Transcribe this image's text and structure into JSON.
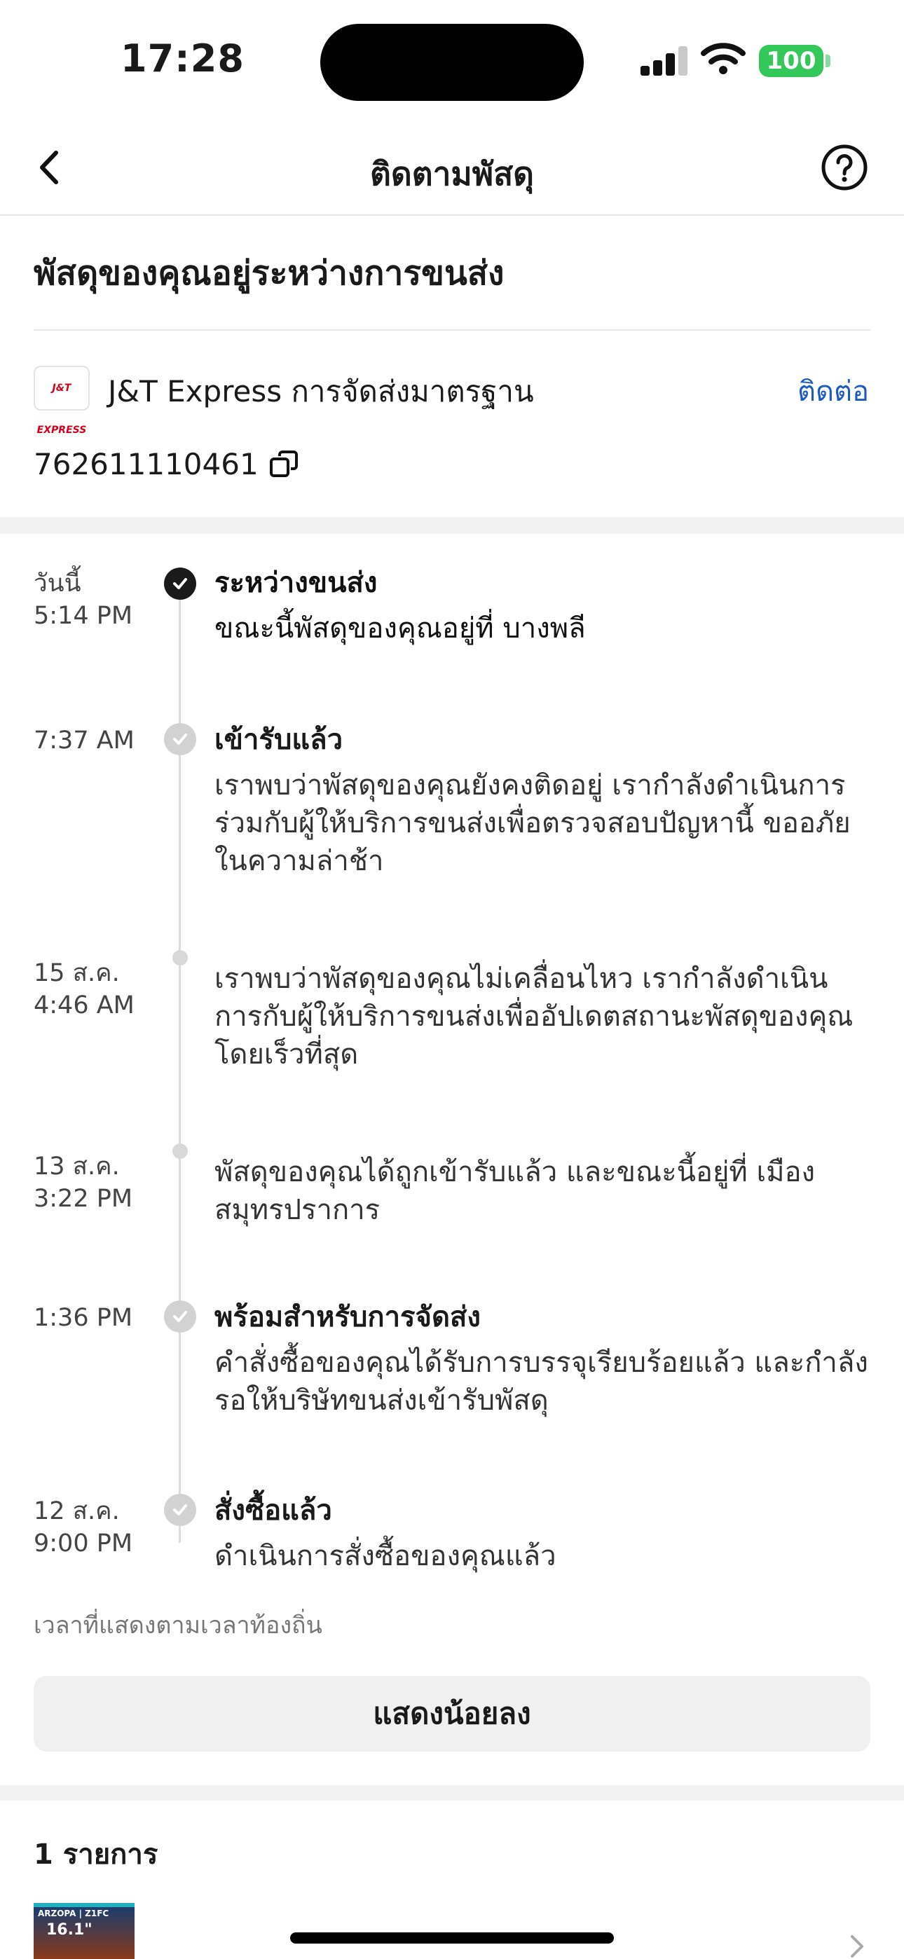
{
  "status_bar": {
    "time": "17:28",
    "battery": "100"
  },
  "nav": {
    "title": "ติดตามพัสดุ"
  },
  "summary": {
    "title": "พัสดุของคุณอยู่ระหว่างการขนส่ง"
  },
  "courier": {
    "logo_text": "J&T EXPRESS",
    "name": "J&T Express การจัดส่งมาตรฐาน",
    "contact_label": "ติดต่อ",
    "tracking_number": "762611110461"
  },
  "timeline": [
    {
      "date": "วันนี้",
      "time": "5:14 PM",
      "title": "ระหว่างขนส่ง",
      "description": "ขณะนี้พัสดุของคุณอยู่ที่ บางพลี",
      "status": "current"
    },
    {
      "date": "",
      "time": "7:37 AM",
      "title": "เข้ารับแล้ว",
      "description": "เราพบว่าพัสดุของคุณยังคงติดอยู่ เรากำลังดำเนินการร่วมกับผู้ให้บริการขนส่งเพื่อตรวจสอบปัญหานี้ ขออภัยในความล่าช้า",
      "status": "done"
    },
    {
      "date": "15 ส.ค.",
      "time": "4:46 AM",
      "title": "",
      "description": "เราพบว่าพัสดุของคุณไม่เคลื่อนไหว เรากำลังดำเนินการกับผู้ให้บริการขนส่งเพื่ออัปเดตสถานะพัสดุของคุณโดยเร็วที่สุด",
      "status": "minor"
    },
    {
      "date": "13 ส.ค.",
      "time": "3:22 PM",
      "title": "",
      "description": "พัสดุของคุณได้ถูกเข้ารับแล้ว และขณะนี้อยู่ที่ เมืองสมุทรปราการ",
      "status": "minor"
    },
    {
      "date": "",
      "time": "1:36 PM",
      "title": "พร้อมสำหรับการจัดส่ง",
      "description": "คำสั่งซื้อของคุณได้รับการบรรจุเรียบร้อยแล้ว และกำลังรอให้บริษัทขนส่งเข้ารับพัสดุ",
      "status": "done"
    },
    {
      "date": "12 ส.ค.",
      "time": "9:00 PM",
      "title": "สั่งซื้อแล้ว",
      "description": "ดำเนินการสั่งซื้อของคุณแล้ว",
      "status": "done"
    }
  ],
  "timezone_note": "เวลาที่แสดงตามเวลาท้องถิ่น",
  "show_less_label": "แสดงน้อยลง",
  "items": {
    "count_label": "1 รายการ",
    "thumb_brand": "ARZOPA | Z1FC",
    "thumb_size": "16.1\""
  },
  "icons": {
    "back": "chevron-left-icon",
    "help": "question-circle-icon",
    "copy": "copy-icon",
    "check": "check-icon",
    "chevron_right": "chevron-right-icon"
  },
  "colors": {
    "link": "#1d5bbf",
    "battery": "#34c759",
    "active_dot": "#1a1a1a",
    "inactive_dot": "#d2d2d2"
  }
}
